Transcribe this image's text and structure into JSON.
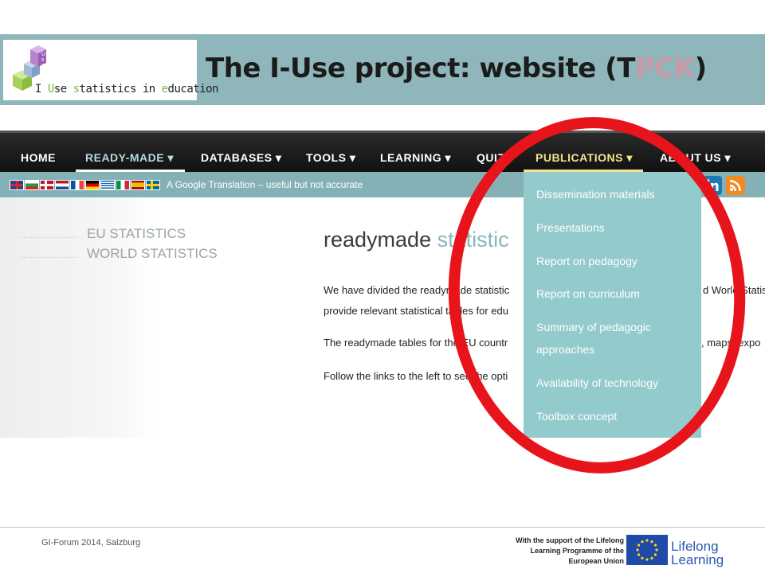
{
  "slide": {
    "title_main": "The I-Use project: website (T",
    "title_faded": "PCK",
    "title_end": ")",
    "logo": {
      "text_parts": [
        "I ",
        "U",
        "se ",
        "s",
        "tatistics in ",
        "e",
        "ducation"
      ],
      "cube_letters": [
        "U",
        "s",
        "e"
      ]
    }
  },
  "navbar": {
    "items": [
      {
        "label": "HOME"
      },
      {
        "label": "READY-MADE ▾"
      },
      {
        "label": "DATABASES ▾"
      },
      {
        "label": "TOOLS ▾"
      },
      {
        "label": "LEARNING ▾"
      },
      {
        "label": "QUIZ"
      },
      {
        "label": "PUBLICATIONS ▾"
      },
      {
        "label": "ABOUT US ▾"
      }
    ]
  },
  "flagbar": {
    "text": "A Google Translation – useful but not accurate",
    "flags": [
      "uk",
      "bulgaria",
      "denmark",
      "netherlands",
      "france",
      "germany",
      "greece",
      "italy",
      "spain",
      "sweden"
    ],
    "social": [
      "linkedin-icon",
      "rss-icon"
    ]
  },
  "sidebar": {
    "links": [
      "EU STATISTICS",
      "WORLD STATISTICS"
    ]
  },
  "content": {
    "title_main": "readymade ",
    "title_accent": "statistic",
    "paragraphs": [
      "We have divided the readymade statistic",
      "d World Statis",
      "provide relevant statistical tables for edu",
      "The readymade tables for the EU countr",
      ", maps, expo",
      "Follow the links to the left to see the opti"
    ]
  },
  "dropdown": {
    "items": [
      "Dissemination materials",
      "Presentations",
      "Report on pedagogy",
      "Report on curriculum",
      "Summary of pedagogic approaches",
      "Availability of technology",
      "Toolbox concept"
    ]
  },
  "footer": {
    "left": "GI-Forum 2014, Salzburg",
    "support_lines": [
      "With the support of the Lifelong",
      "Learning Programme of the",
      "European Union"
    ],
    "lifelong": [
      "Lifelong",
      "Learning"
    ]
  },
  "colors": {
    "banner": "#8fb6bb",
    "dropdown": "#93cacb",
    "annotation": "#e8141c",
    "publications": "#f2e38c"
  }
}
